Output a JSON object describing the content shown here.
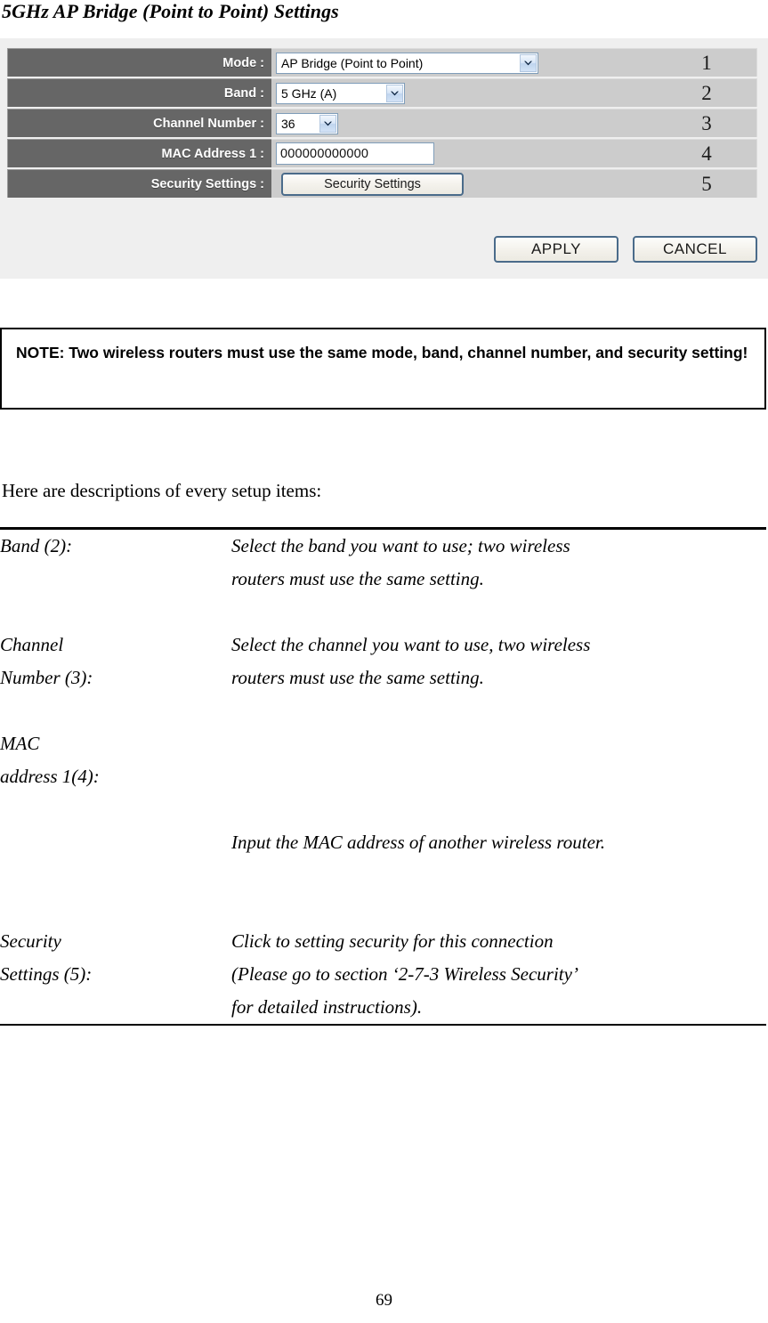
{
  "document": {
    "title": "5GHz AP Bridge (Point to Point) Settings",
    "page_number": "69"
  },
  "ui_panel": {
    "rows": [
      {
        "label": "Mode :",
        "control": "dropdown",
        "value": "AP Bridge (Point to Point)",
        "marker": "1"
      },
      {
        "label": "Band :",
        "control": "dropdown",
        "value": "5 GHz (A)",
        "marker": "2"
      },
      {
        "label": "Channel Number :",
        "control": "dropdown",
        "value": "36",
        "marker": "3"
      },
      {
        "label": "MAC Address 1 :",
        "control": "text-input",
        "value": "000000000000",
        "marker": "4"
      },
      {
        "label": "Security Settings :",
        "control": "button",
        "value": "Security Settings",
        "marker": "5"
      }
    ],
    "actions": {
      "apply_label": "APPLY",
      "cancel_label": "CANCEL"
    },
    "colors": {
      "panel_background": "#efefef",
      "label_cell": "#666666",
      "value_cell": "#cccccc",
      "input_border": "#7f9db9",
      "button_border": "#4a6b8a"
    }
  },
  "note": {
    "text": "NOTE: Two wireless routers must use the same mode, band, channel number, and security setting!"
  },
  "descriptions": {
    "intro": "Here are descriptions of every setup items:",
    "items": [
      {
        "term": "Band (2):",
        "definition": "Select the band you want to use; two wireless\nrouters must use the same setting."
      },
      {
        "term": "Channel\nNumber (3):",
        "definition": "Select the channel you want to use, two wireless\nrouters must use the same setting."
      },
      {
        "term": "MAC\naddress 1(4):",
        "definition": "Input the MAC address of another wireless router."
      },
      {
        "term": "Security\nSettings (5):",
        "definition": "Click to setting security for this connection\n(Please go to section ‘2-7-3 Wireless Security’\nfor detailed instructions)."
      }
    ]
  }
}
